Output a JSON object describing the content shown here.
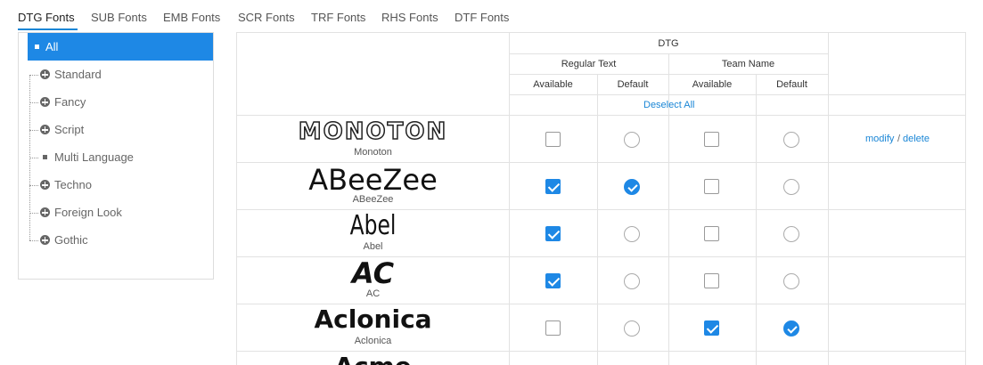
{
  "tabs": [
    {
      "label": "DTG Fonts",
      "active": true
    },
    {
      "label": "SUB Fonts",
      "active": false
    },
    {
      "label": "EMB Fonts",
      "active": false
    },
    {
      "label": "SCR Fonts",
      "active": false
    },
    {
      "label": "TRF Fonts",
      "active": false
    },
    {
      "label": "RHS Fonts",
      "active": false
    },
    {
      "label": "DTF Fonts",
      "active": false
    }
  ],
  "sidebar": {
    "items": [
      {
        "label": "All",
        "icon": "square-icon",
        "selected": true
      },
      {
        "label": "Standard",
        "icon": "plus-circle-icon",
        "selected": false
      },
      {
        "label": "Fancy",
        "icon": "plus-circle-icon",
        "selected": false
      },
      {
        "label": "Script",
        "icon": "plus-circle-icon",
        "selected": false
      },
      {
        "label": "Multi Language",
        "icon": "square-icon",
        "selected": false
      },
      {
        "label": "Techno",
        "icon": "plus-circle-icon",
        "selected": false
      },
      {
        "label": "Foreign Look",
        "icon": "plus-circle-icon",
        "selected": false
      },
      {
        "label": "Gothic",
        "icon": "plus-circle-icon",
        "selected": false
      }
    ]
  },
  "table": {
    "group_header": "DTG",
    "regular_text_header": "Regular Text",
    "team_name_header": "Team Name",
    "available_label": "Available",
    "default_label": "Default",
    "deselect_all": "Deselect All",
    "modify_label": "modify",
    "separator": "/",
    "delete_label": "delete",
    "rows": [
      {
        "sample": "MONOTON",
        "name": "Monoton",
        "rt_available": false,
        "rt_default": false,
        "tn_available": false,
        "tn_default": false
      },
      {
        "sample": "ABeeZee",
        "name": "ABeeZee",
        "rt_available": true,
        "rt_default": true,
        "tn_available": false,
        "tn_default": false
      },
      {
        "sample": "Abel",
        "name": "Abel",
        "rt_available": true,
        "rt_default": false,
        "tn_available": false,
        "tn_default": false
      },
      {
        "sample": "AC",
        "name": "AC",
        "rt_available": true,
        "rt_default": false,
        "tn_available": false,
        "tn_default": false
      },
      {
        "sample": "Aclonica",
        "name": "Aclonica",
        "rt_available": false,
        "rt_default": false,
        "tn_available": true,
        "tn_default": true
      },
      {
        "sample": "Acme",
        "name": "",
        "rt_available": false,
        "rt_default": false,
        "tn_available": false,
        "tn_default": false
      }
    ]
  },
  "colors": {
    "accent": "#1e88e5",
    "link": "#1a86d6",
    "border": "#e2e2e2"
  }
}
